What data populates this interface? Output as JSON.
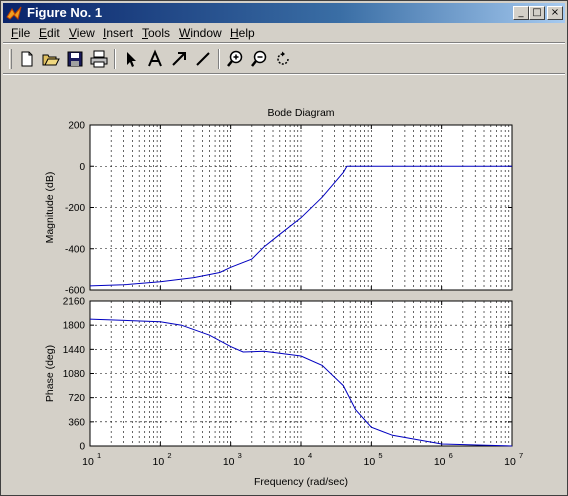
{
  "window": {
    "title": "Figure No. 1"
  },
  "menu": [
    {
      "label": "File",
      "u": "F",
      "rest": "ile"
    },
    {
      "label": "Edit",
      "u": "E",
      "rest": "dit"
    },
    {
      "label": "View",
      "u": "V",
      "rest": "iew"
    },
    {
      "label": "Insert",
      "u": "I",
      "rest": "nsert"
    },
    {
      "label": "Tools",
      "u": "T",
      "rest": "ools"
    },
    {
      "label": "Window",
      "u": "W",
      "rest": "indow"
    },
    {
      "label": "Help",
      "u": "H",
      "rest": "elp"
    }
  ],
  "toolbar": [
    "new-figure-icon",
    "open-icon",
    "save-icon",
    "print-icon",
    "edit-pointer-icon",
    "insert-text-icon",
    "insert-arrow-icon",
    "insert-line-icon",
    "zoom-in-icon",
    "zoom-out-icon",
    "rotate-3d-icon"
  ],
  "colors": {
    "line": "#0000c0",
    "titlebar_start": "#0a246a",
    "titlebar_end": "#a6caf0",
    "figure_bg": "#d4d0c8"
  },
  "chart_data": {
    "type": "line",
    "title": "Bode Diagram",
    "xlabel": "Frequency  (rad/sec)",
    "xscale": "log",
    "xlim": [
      10,
      10000000
    ],
    "xticks": [
      {
        "exp": "1"
      },
      {
        "exp": "2"
      },
      {
        "exp": "3"
      },
      {
        "exp": "4"
      },
      {
        "exp": "5"
      },
      {
        "exp": "6"
      },
      {
        "exp": "7"
      }
    ],
    "grid": true,
    "magnitude": {
      "ylabel": "Magnitude (dB)",
      "ylim": [
        -600,
        200
      ],
      "yticks": [
        200,
        0,
        -200,
        -400,
        -600
      ],
      "x": [
        10,
        30,
        100,
        300,
        700,
        1000,
        2000,
        3000,
        5000,
        10000,
        20000,
        40000,
        45000,
        100000,
        1000000,
        10000000
      ],
      "y": [
        -580,
        -575,
        -560,
        -540,
        -515,
        -490,
        -450,
        -390,
        -330,
        -250,
        -150,
        -30,
        0,
        0,
        0,
        0
      ]
    },
    "phase": {
      "ylabel": "Phase (deg)",
      "ylim": [
        0,
        2160
      ],
      "yticks": [
        2160,
        1800,
        1440,
        1080,
        720,
        360,
        0
      ],
      "x": [
        10,
        100,
        200,
        500,
        1000,
        1500,
        3000,
        10000,
        20000,
        40000,
        60000,
        100000,
        200000,
        1000000,
        10000000
      ],
      "y": [
        1890,
        1850,
        1800,
        1650,
        1480,
        1400,
        1410,
        1340,
        1200,
        900,
        540,
        280,
        160,
        30,
        0
      ]
    }
  }
}
